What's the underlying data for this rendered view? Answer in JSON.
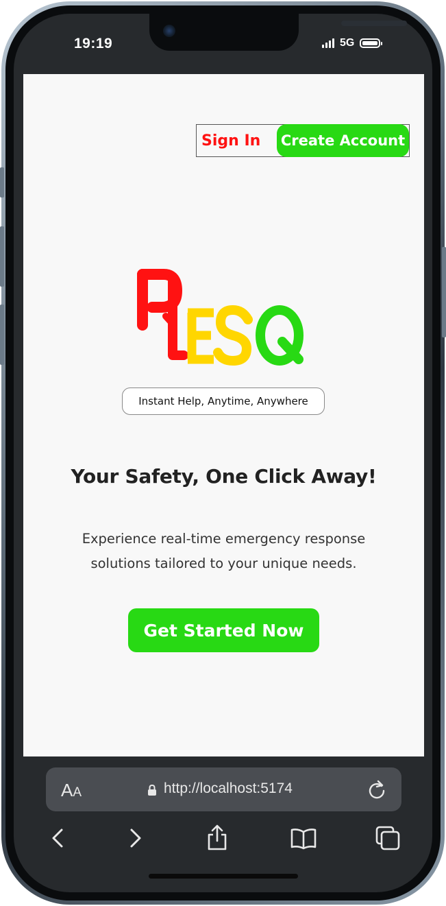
{
  "status_bar": {
    "time": "19:19",
    "network": "5G"
  },
  "header": {
    "sign_in_label": "Sign In",
    "create_account_label": "Create Account"
  },
  "logo": {
    "letters": [
      "R",
      "E",
      "S",
      "Q"
    ],
    "colors": [
      "#ff1212",
      "#ffd600",
      "#ffd600",
      "#28d914"
    ]
  },
  "hero": {
    "tagline": "Instant Help, Anytime, Anywhere",
    "headline": "Your Safety, One Click Away!",
    "subtext_line1": "Experience real-time emergency response",
    "subtext_line2": "solutions tailored to your unique needs.",
    "cta_label": "Get Started Now"
  },
  "browser": {
    "text_size_label_big": "A",
    "text_size_label_small": "A",
    "url": "http://localhost:5174",
    "toolbar_icons": [
      "back-icon",
      "forward-icon",
      "share-icon",
      "bookmarks-icon",
      "tabs-icon"
    ]
  },
  "colors": {
    "accent_green": "#28d914",
    "accent_red": "#ff1212",
    "accent_yellow": "#ffd600",
    "page_bg": "#f8f8f8"
  }
}
